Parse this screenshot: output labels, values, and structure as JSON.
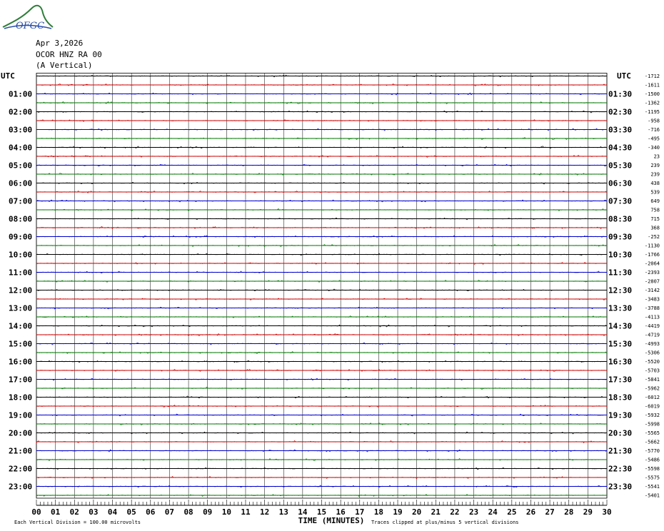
{
  "header": {
    "logo_text": "OFGC",
    "date": "Apr 3,2026",
    "station": "OCOR HNZ RA 00",
    "component": "(A Vertical)"
  },
  "chart_data": {
    "type": "helicorder",
    "left_axis_title": "UTC",
    "right_axis_title": "UTC",
    "left_labels": [
      "01:00",
      "02:00",
      "03:00",
      "04:00",
      "05:00",
      "06:00",
      "07:00",
      "08:00",
      "09:00",
      "10:00",
      "11:00",
      "12:00",
      "13:00",
      "14:00",
      "15:00",
      "16:00",
      "17:00",
      "18:00",
      "19:00",
      "20:00",
      "21:00",
      "22:00",
      "23:00"
    ],
    "right_labels": [
      "01:30",
      "02:30",
      "03:30",
      "04:30",
      "05:30",
      "06:30",
      "07:30",
      "08:30",
      "09:30",
      "10:30",
      "11:30",
      "12:30",
      "13:30",
      "14:30",
      "15:30",
      "16:30",
      "17:30",
      "18:30",
      "19:30",
      "20:30",
      "21:30",
      "22:30",
      "23:30"
    ],
    "trace_offsets": [
      "-1712",
      "-1611",
      "-1500",
      "-1362",
      "-1195",
      "-958",
      "-716",
      "-495",
      "-340",
      "23",
      "239",
      "239",
      "438",
      "539",
      "649",
      "758",
      "715",
      "368",
      "-252",
      "-1130",
      "-1766",
      "-2064",
      "-2393",
      "-2807",
      "-3142",
      "-3483",
      "-3788",
      "-4113",
      "-4419",
      "-4719",
      "-4993",
      "-5306",
      "-5520",
      "-5703",
      "-5841",
      "-5962",
      "-6012",
      "-6019",
      "-5932",
      "-5998",
      "-5565",
      "-5662",
      "-5770",
      "-5486",
      "-5598",
      "-5575",
      "-5541",
      "-5401"
    ],
    "x_ticks": [
      "00",
      "01",
      "02",
      "03",
      "04",
      "05",
      "06",
      "07",
      "08",
      "09",
      "10",
      "11",
      "12",
      "13",
      "14",
      "15",
      "16",
      "17",
      "18",
      "19",
      "20",
      "21",
      "22",
      "23",
      "24",
      "25",
      "26",
      "27",
      "28",
      "29",
      "30"
    ],
    "xlabel": "TIME (MINUTES)",
    "xlim": [
      0,
      30
    ],
    "line_colors": [
      "#000000",
      "#cc0000",
      "#0000cc",
      "#007700"
    ],
    "grid_color": "#000000",
    "footer_left": "Each Vertical Division =  100.00 microvolts",
    "footer_right": "Traces clipped at plus/minus 5 vertical divisions"
  }
}
